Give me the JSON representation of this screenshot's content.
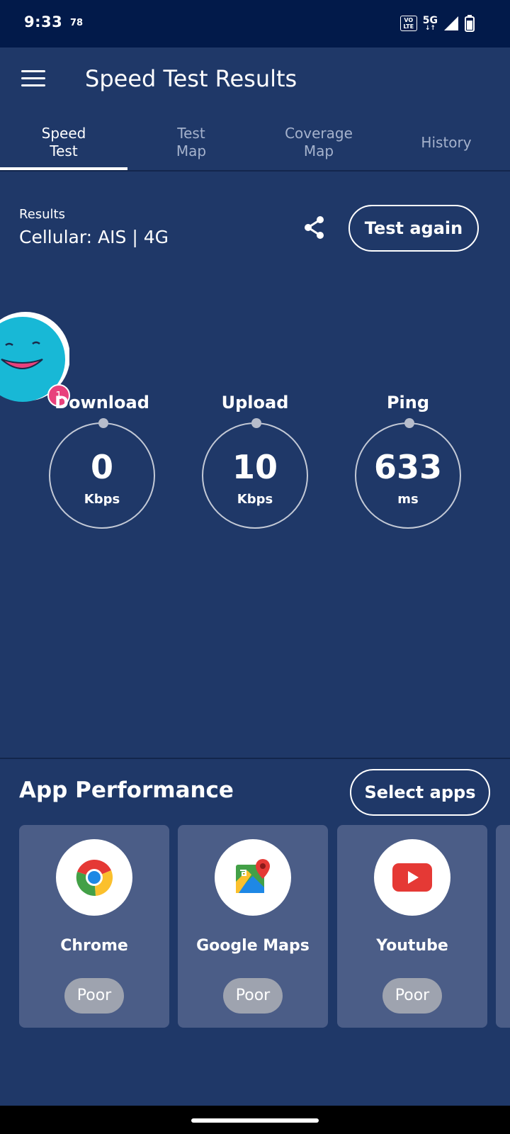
{
  "status_bar": {
    "time": "9:33",
    "notification_count": "78",
    "volte": "VoLTE",
    "network": "5G",
    "network_arrows": "↓↑"
  },
  "app_bar": {
    "title": "Speed Test Results"
  },
  "tabs": [
    {
      "label_line1": "Speed",
      "label_line2": "Test",
      "active": true
    },
    {
      "label_line1": "Test",
      "label_line2": "Map",
      "active": false
    },
    {
      "label_line1": "Coverage",
      "label_line2": "Map",
      "active": false
    },
    {
      "label_line1": "History",
      "label_line2": "",
      "active": false
    }
  ],
  "results": {
    "label": "Results",
    "connection": "Cellular: AIS | 4G",
    "test_again_label": "Test again"
  },
  "mascot": {
    "badge_count": "1"
  },
  "metrics": [
    {
      "label": "Download",
      "value": "0",
      "unit": "Kbps"
    },
    {
      "label": "Upload",
      "value": "10",
      "unit": "Kbps"
    },
    {
      "label": "Ping",
      "value": "633",
      "unit": "ms"
    }
  ],
  "app_performance": {
    "title": "App Performance",
    "select_apps_label": "Select apps",
    "apps": [
      {
        "name": "Chrome",
        "status": "Poor",
        "icon": "chrome-icon"
      },
      {
        "name": "Google Maps",
        "status": "Poor",
        "icon": "google-maps-icon"
      },
      {
        "name": "Youtube",
        "status": "Poor",
        "icon": "youtube-icon"
      }
    ]
  },
  "colors": {
    "background": "#1f3868",
    "status_bar": "#021a4a",
    "card": "#4b5d87",
    "badge": "#e8417c",
    "status_pill": "#9ea3af"
  }
}
